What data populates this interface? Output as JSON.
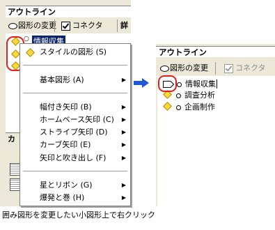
{
  "left_panel": {
    "title": "アウトライン",
    "toolbar": {
      "change_shape": "図形の変更",
      "connector": "コネクタ",
      "cutoff": "詳"
    },
    "selected_item": "情報収集",
    "bottom_tab": "カ"
  },
  "context_menu": {
    "items": [
      {
        "label": "スタイルの図形 (S)",
        "has_icon": true,
        "submenu": false
      },
      {
        "label": "基本図形 (A)",
        "submenu": true
      },
      {
        "label": "幅付き矢印 (B)",
        "submenu": true
      },
      {
        "label": "ホームベース矢印 (C)",
        "submenu": true
      },
      {
        "label": "ストライプ矢印 (D)",
        "submenu": true
      },
      {
        "label": "カーブ矢印 (E)",
        "submenu": true
      },
      {
        "label": "矢印と吹き出し (F)",
        "submenu": true
      },
      {
        "label": "星とリボン (G)",
        "submenu": true
      },
      {
        "label": "爆発と巻 (H)",
        "submenu": true
      }
    ]
  },
  "right_panel": {
    "title": "アウトライン",
    "toolbar": {
      "change_shape": "図形の変更",
      "connector": "コネクタ"
    },
    "items": [
      "情報収集",
      "調査分析",
      "企画制作"
    ]
  },
  "caption": "囲み図形を変更したい小図形上で右クリック",
  "colors": {
    "highlight": "#e0201a",
    "selection": "#0a246a",
    "arrow": "#1f57d6",
    "diamond": "#ffd83a"
  }
}
